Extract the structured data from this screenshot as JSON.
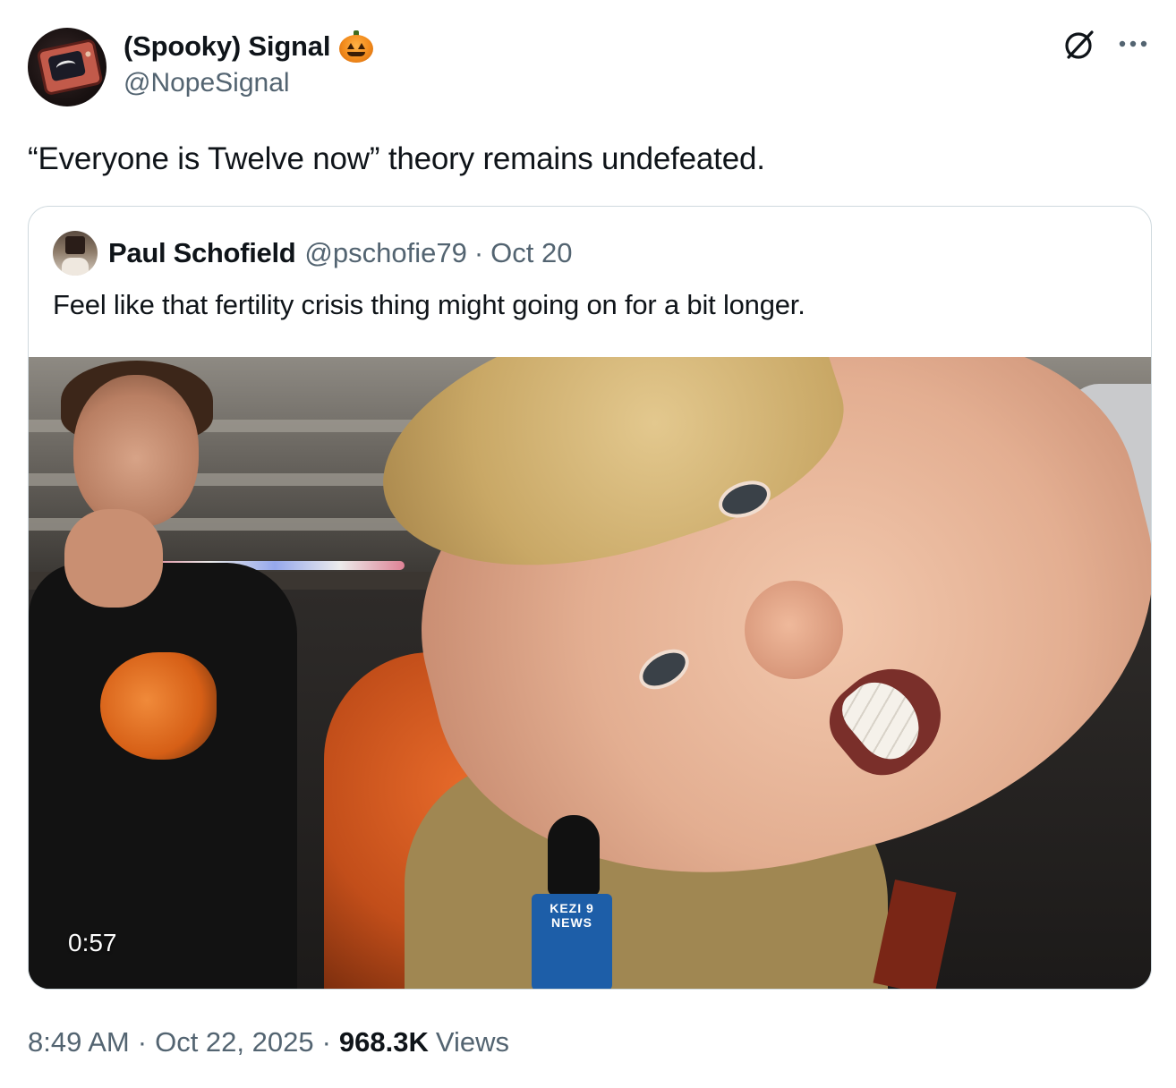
{
  "author": {
    "display_name": "(Spooky) Signal",
    "display_name_emoji": "pumpkin-emoji",
    "handle": "@NopeSignal"
  },
  "header_icons": {
    "grok": "grok-icon",
    "more": "more-icon"
  },
  "tweet": {
    "text": "“Everyone is Twelve now” theory remains undefeated."
  },
  "quote": {
    "author_name": "Paul Schofield",
    "handle": "@pschofie79",
    "separator": "·",
    "date": "Oct 20",
    "text": "Feel like that fertility crisis thing might going on for a bit longer.",
    "video": {
      "duration": "0:57",
      "mic_flag_label": "KEZI 9 NEWS"
    }
  },
  "footer": {
    "time": "8:49 AM",
    "separator": "·",
    "date": "Oct 22, 2025",
    "views_count": "968.3K",
    "views_label": "Views"
  },
  "colors": {
    "text_primary": "#0f1419",
    "text_secondary": "#536471",
    "border": "#cfd9de",
    "background": "#ffffff"
  }
}
